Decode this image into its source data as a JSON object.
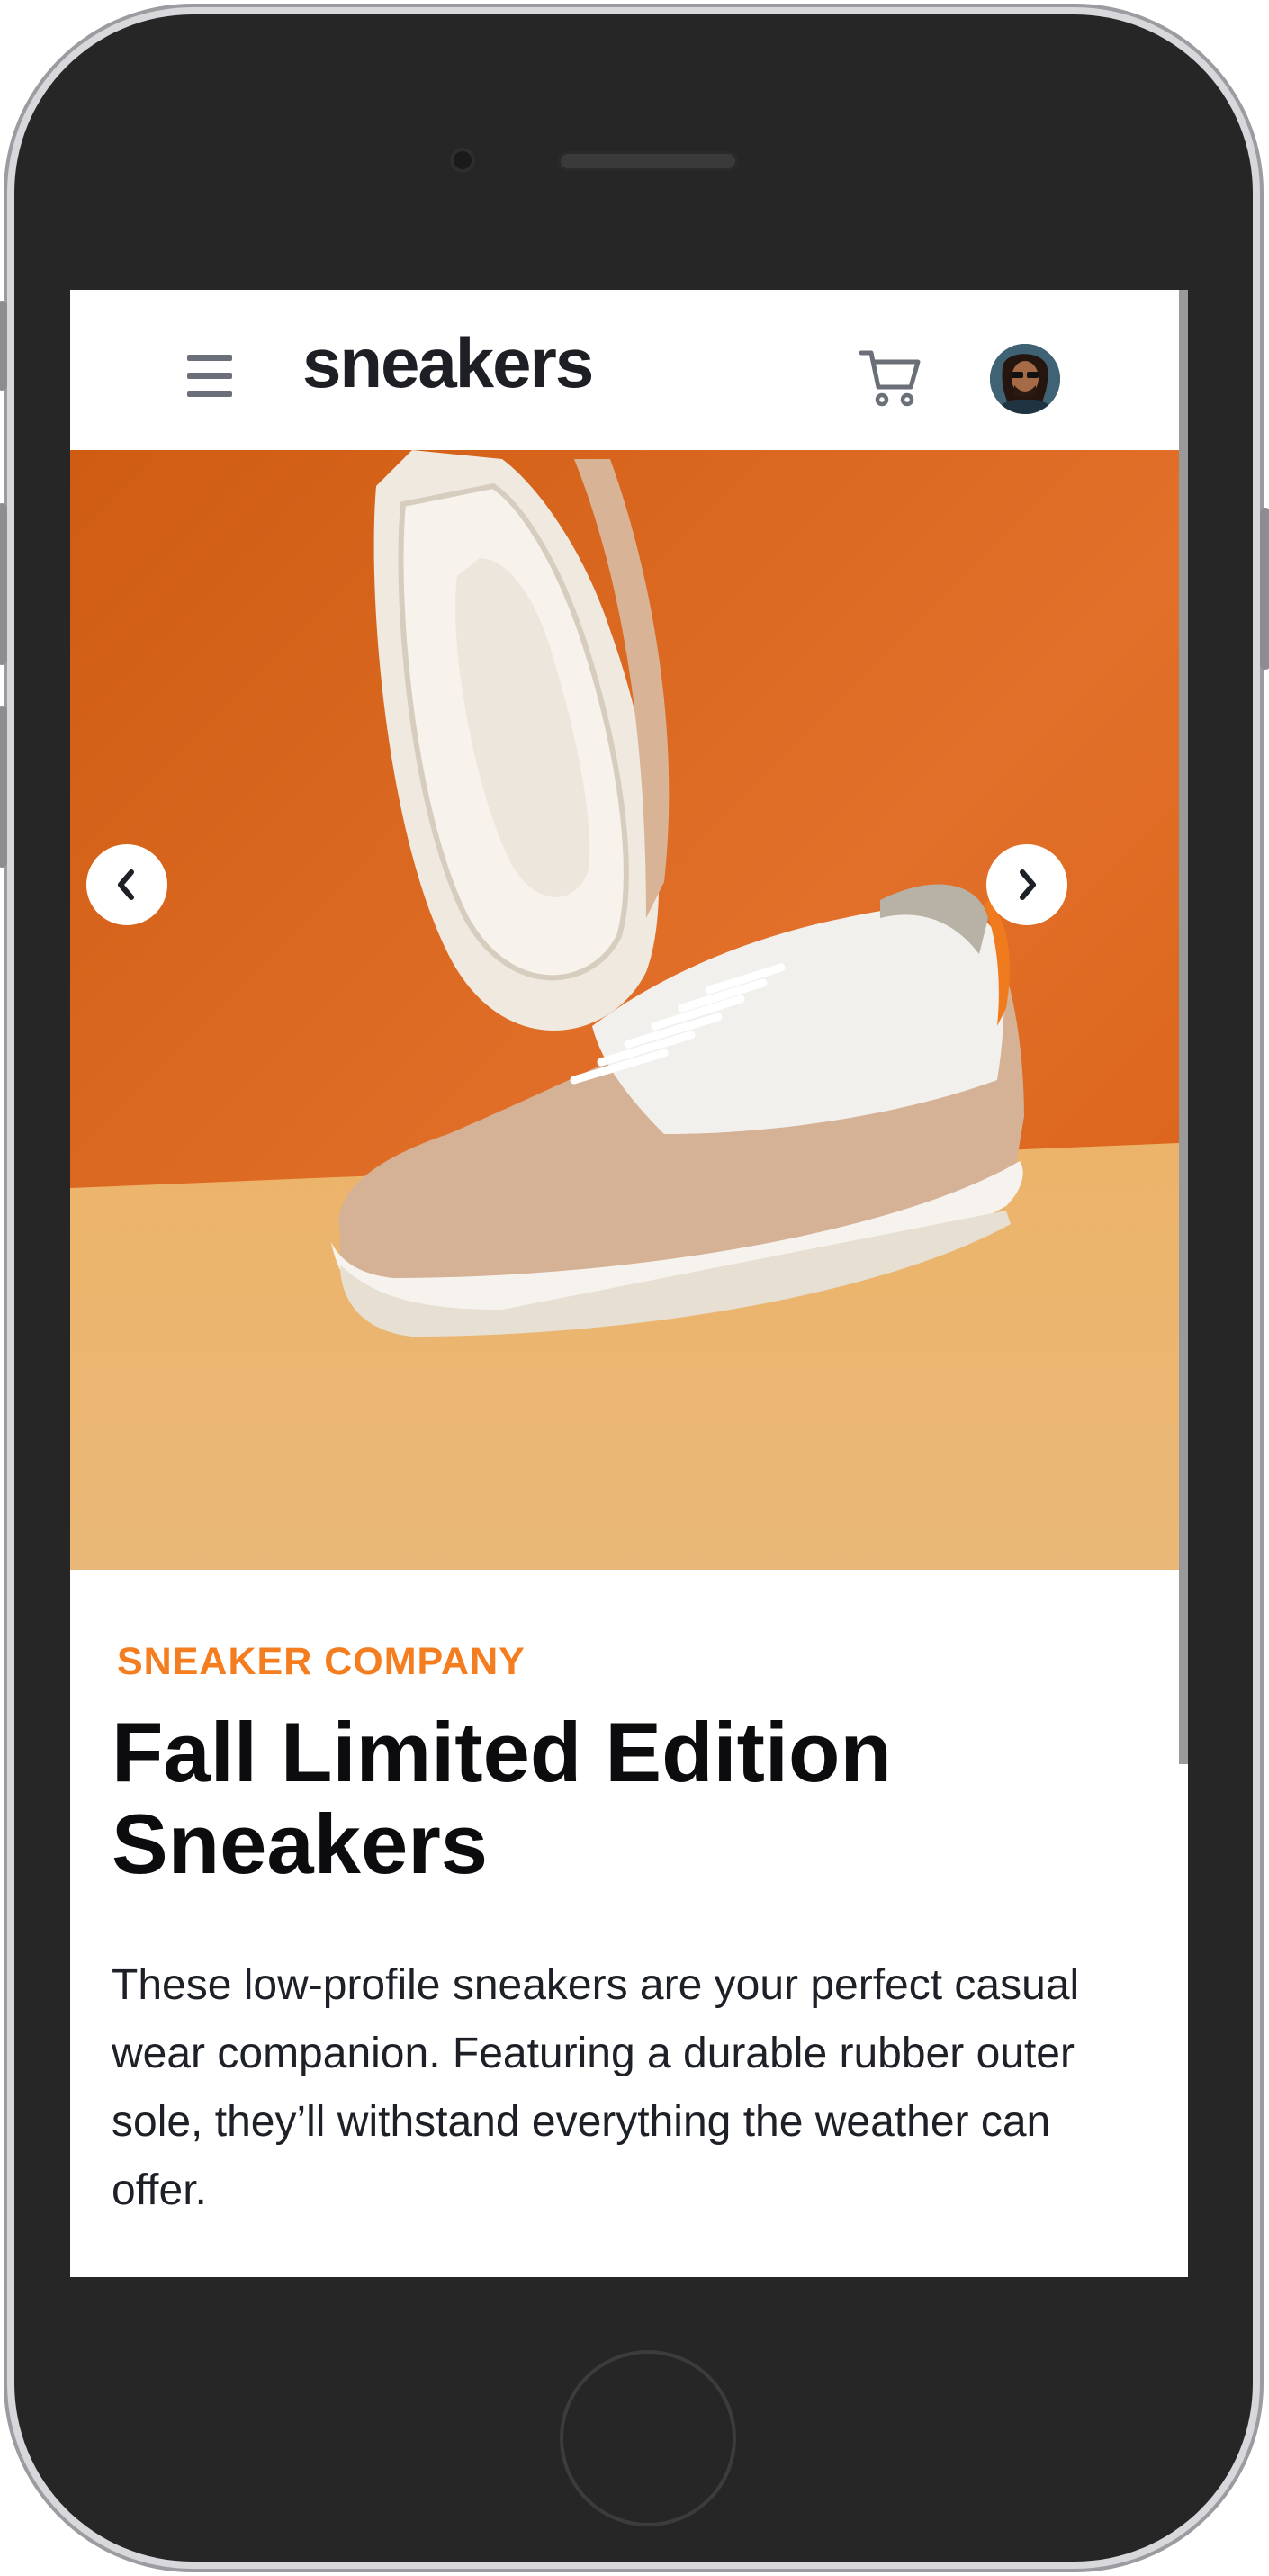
{
  "header": {
    "logo": "sneakers",
    "menu_icon": "hamburger-menu-icon",
    "cart_icon": "cart-icon",
    "avatar_icon": "user-avatar"
  },
  "gallery": {
    "image": "sneaker-product-photo",
    "prev_icon": "chevron-left-icon",
    "next_icon": "chevron-right-icon"
  },
  "product": {
    "company": "SNEAKER COMPANY",
    "title": "Fall Limited Edition Sneakers",
    "description": "These low-profile sneakers are your perfect casual wear companion. Featuring a durable rubber outer sole, they’ll withstand everything the weather can offer."
  },
  "colors": {
    "accent": "#f47d1f",
    "text_dark": "#0c0c0e",
    "icon_gray": "#6b6f78",
    "bg_orange": "#e06b1c",
    "floor_tan": "#e8b46c"
  }
}
